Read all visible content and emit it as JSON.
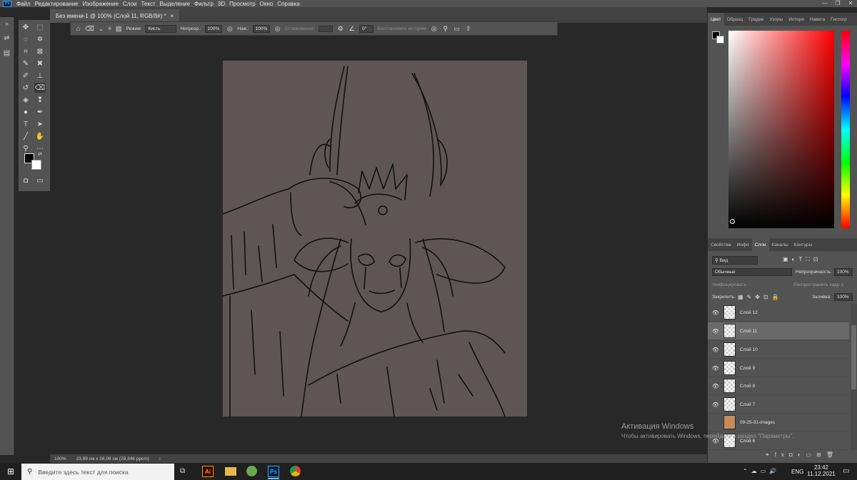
{
  "menu": {
    "app_icon": "Ps",
    "items": [
      "Файл",
      "Редактирование",
      "Изображение",
      "Слои",
      "Текст",
      "Выделение",
      "Фильтр",
      "3D",
      "Просмотр",
      "Окно",
      "Справка"
    ]
  },
  "window_controls": {
    "minimize": "—",
    "maximize": "❐",
    "close": "✕"
  },
  "doc_tab": {
    "title": "Без имени-1 @ 100% (Слой 11, RGB/8#) *",
    "close": "×"
  },
  "options": {
    "brush_size": "6",
    "mode_label": "Режим:",
    "mode_value": "Кисть",
    "opacity_label": "Непрозр.:",
    "opacity_value": "100%",
    "pressure_label": "Наж.:",
    "pressure_value": "100%",
    "smoothing_label": "Сглаживание:",
    "angle_value": "0°",
    "restore_history": "Восстановить историю"
  },
  "canvas": {
    "background_color": "#5f5556",
    "line_color": "#111111"
  },
  "status": {
    "zoom": "100%",
    "doc_size": "23,99 см x 28,08 см (28,346 ppcm)"
  },
  "panels": {
    "color_tabs": [
      "Цвет",
      "Образц",
      "Градие",
      "Узоры",
      "Истори",
      "Навига",
      "Гистогр"
    ],
    "props_tabs": [
      "Свойства",
      "Инфо",
      "Слои",
      "Каналы",
      "Контуры"
    ],
    "layers_filter": "Вид",
    "blend_mode": "Обычные",
    "opacity_label": "Непрозрачность:",
    "opacity_value": "100%",
    "unify_label": "Унифицировать:",
    "propagate_label": "Распространить кадр 1",
    "lock_label": "Закрепить:",
    "fill_label": "Заливка:",
    "fill_value": "100%",
    "layers": [
      {
        "name": "Слой 12",
        "visible": true,
        "selected": false
      },
      {
        "name": "Слой 11",
        "visible": true,
        "selected": true
      },
      {
        "name": "Слой 10",
        "visible": true,
        "selected": false
      },
      {
        "name": "Слой 9",
        "visible": true,
        "selected": false
      },
      {
        "name": "Слой 8",
        "visible": true,
        "selected": false
      },
      {
        "name": "Слой 7",
        "visible": true,
        "selected": false
      },
      {
        "name": "09-25-31-images",
        "visible": false,
        "selected": false
      },
      {
        "name": "Слой 6",
        "visible": true,
        "selected": false
      }
    ]
  },
  "watermark": {
    "title": "Активация Windows",
    "subtitle": "Чтобы активировать Windows, перейдите в раздел \"Параметры\"."
  },
  "taskbar": {
    "search_placeholder": "Введите здесь текст для поиска",
    "lang": "ENG",
    "time": "23:42",
    "date": "11.12.2021",
    "apps": [
      "Ai",
      "Ps"
    ]
  }
}
